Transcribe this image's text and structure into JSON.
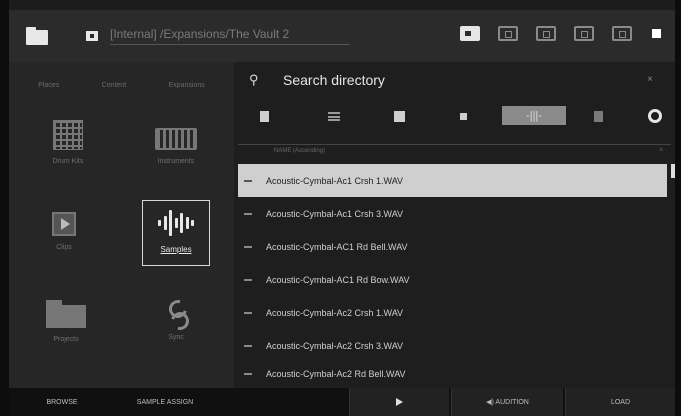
{
  "topbar": {
    "path": "[Internal] /Expansions/The Vault 2",
    "icons": [
      "folder-icon",
      "drive-icon",
      "folder-solid-icon",
      "folder-up-icon",
      "folder-back-icon",
      "folder-add-icon",
      "folder-remove-icon",
      "stop-icon"
    ]
  },
  "left_panel": {
    "tabs": [
      "Places",
      "Content",
      "Expansions"
    ],
    "categories": [
      {
        "label": "Drum Kits",
        "icon": "grid-icon"
      },
      {
        "label": "Instruments",
        "icon": "keyboard-icon"
      },
      {
        "label": "Clips",
        "icon": "play-icon"
      },
      {
        "label": "Samples",
        "icon": "waveform-icon",
        "selected": true
      },
      {
        "label": "Projects",
        "icon": "folder-icon"
      },
      {
        "label": "Sync",
        "icon": "sync-icon"
      }
    ]
  },
  "right_panel": {
    "search_label": "Search directory",
    "close_label": "×",
    "tools": [
      "doc-icon",
      "list-icon",
      "square-icon",
      "speaker-icon",
      "audition-icon",
      "copy-icon",
      "gear-icon"
    ],
    "audition_label": "-|||-",
    "column_header": "NAME (Ascending)",
    "files": [
      {
        "name": "Acoustic-Cymbal-Ac1 Crsh 1.WAV",
        "selected": true
      },
      {
        "name": "Acoustic-Cymbal-Ac1 Crsh 3.WAV"
      },
      {
        "name": "Acoustic-Cymbal-AC1 Rd Bell.WAV"
      },
      {
        "name": "Acoustic-Cymbal-AC1 Rd Bow.WAV"
      },
      {
        "name": "Acoustic-Cymbal-Ac2 Crsh 1.WAV"
      },
      {
        "name": "Acoustic-Cymbal-Ac2 Crsh 3.WAV"
      },
      {
        "name": "Acoustic-Cymbal-Ac2 Rd Bell.WAV"
      }
    ]
  },
  "bottombar": {
    "browse": "BROWSE",
    "sample_assign": "SAMPLE ASSIGN",
    "audition": "◀) AUDITION",
    "load": "LOAD"
  }
}
